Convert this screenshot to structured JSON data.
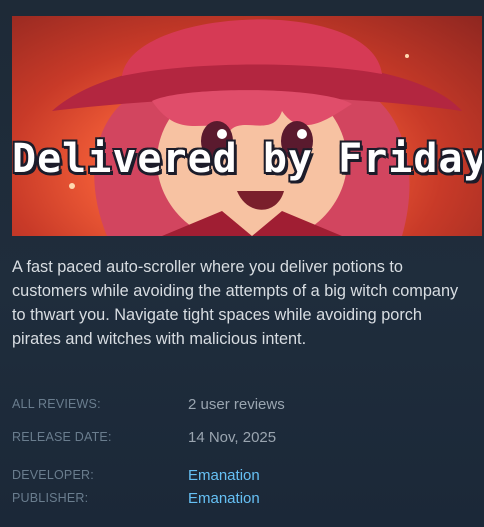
{
  "capsule": {
    "logo_text": "Delivered by Friday"
  },
  "description": "A fast paced auto-scroller where you deliver potions to customers while avoiding the attempts of a big witch company to thwart you. Navigate tight spaces while avoiding porch pirates and witches with malicious intent.",
  "reviews": {
    "label": "ALL REVIEWS:",
    "value": "2 user reviews"
  },
  "release": {
    "label": "RELEASE DATE:",
    "value": "14 Nov, 2025"
  },
  "developer": {
    "label": "DEVELOPER:",
    "value": "Emanation"
  },
  "publisher": {
    "label": "PUBLISHER:",
    "value": "Emanation"
  },
  "colors": {
    "background": "#1b2838",
    "link": "#66c0f4",
    "label": "#6a7d8e",
    "text": "#d8dde2"
  }
}
